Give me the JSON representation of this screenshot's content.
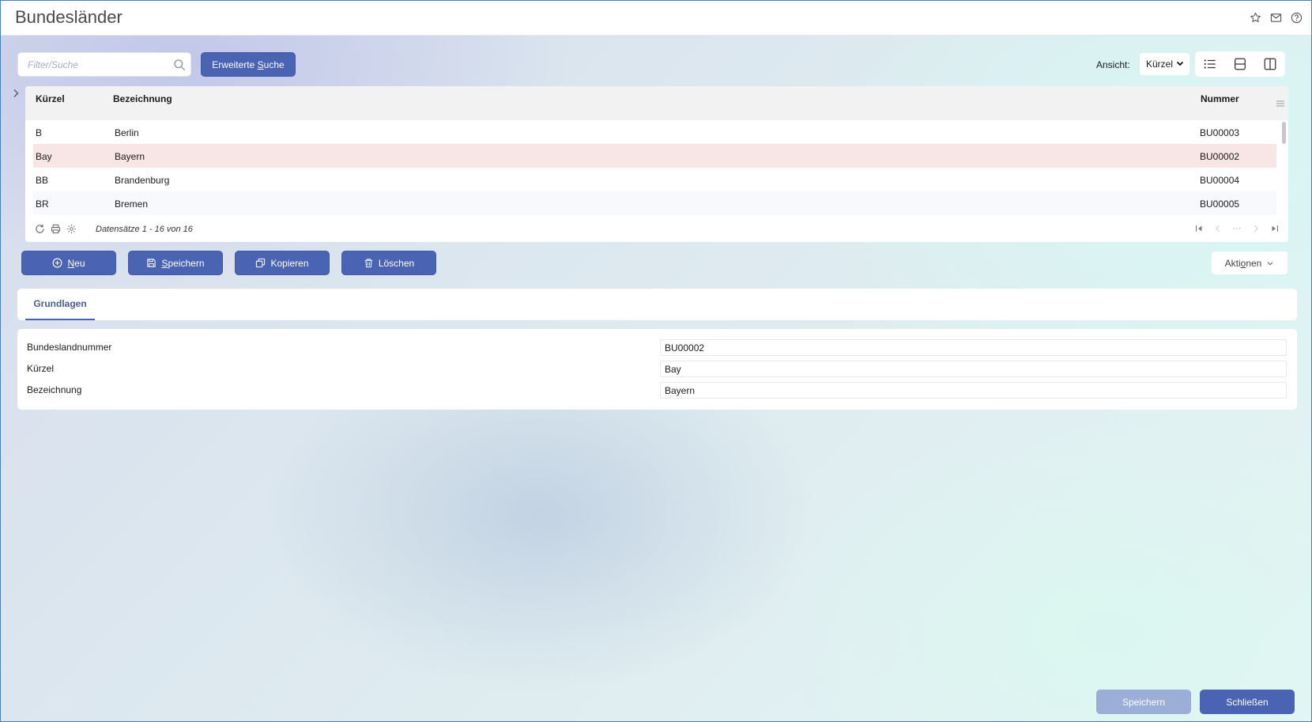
{
  "window": {
    "title": "Bundesländer",
    "icons": [
      "star-icon",
      "mail-icon",
      "help-icon"
    ]
  },
  "search": {
    "placeholder": "Filter/Suche",
    "value": "",
    "extended_prefix": "Erweiterte ",
    "extended_underlined": "S",
    "extended_suffix": "uche"
  },
  "view": {
    "label": "Ansicht:",
    "selected": "Kürzel",
    "options": [
      "Kürzel"
    ]
  },
  "grid": {
    "columns": [
      "Kürzel",
      "Bezeichnung",
      "Nummer"
    ],
    "rows": [
      {
        "kuerzel": "B",
        "bezeichnung": "Berlin",
        "nummer": "BU00003"
      },
      {
        "kuerzel": "Bay",
        "bezeichnung": "Bayern",
        "nummer": "BU00002"
      },
      {
        "kuerzel": "BB",
        "bezeichnung": "Brandenburg",
        "nummer": "BU00004"
      },
      {
        "kuerzel": "BR",
        "bezeichnung": "Bremen",
        "nummer": "BU00005"
      }
    ],
    "selected_row": 1,
    "records_text": "Datensätze 1 - 16 von 16",
    "pager_ellipsis": "···"
  },
  "actions": {
    "new_underlined": "N",
    "new_rest": "eu",
    "save_underlined": "S",
    "save_rest": "peichern",
    "copy": "Kopieren",
    "delete": "Löschen",
    "aktionen_prefix": "Akti",
    "aktionen_underlined": "o",
    "aktionen_suffix": "nen"
  },
  "tabs": {
    "active": "Grundlagen"
  },
  "form": {
    "fields": [
      {
        "label": "Bundeslandnummer",
        "value": "BU00002"
      },
      {
        "label": "Kürzel",
        "value": "Bay"
      },
      {
        "label": "Bezeichnung",
        "value": "Bayern"
      }
    ]
  },
  "footer": {
    "save": "Speichern",
    "close": "Schließen"
  },
  "colors": {
    "primary": "#4a63b3",
    "primary_disabled": "#9aaed8",
    "selected_row": "#f8e6e4",
    "tab_text": "#4a5f8e"
  }
}
